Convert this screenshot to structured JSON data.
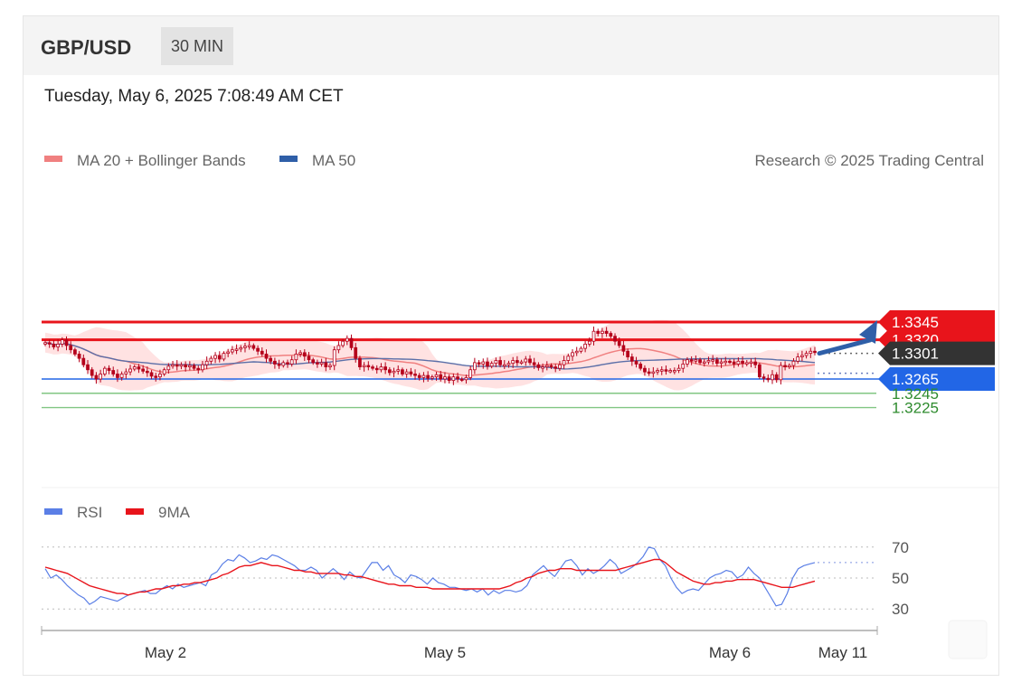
{
  "header": {
    "symbol": "GBP/USD",
    "timeframe": "30 MIN"
  },
  "datetime": "Tuesday, May 6, 2025 7:08:49 AM CET",
  "credit": "Research © 2025 Trading Central",
  "colors": {
    "resistance": "#e8141b",
    "support_blue": "#2266e6",
    "support_green": "#4caf50",
    "last": "#333333",
    "candle": "#b5001b",
    "ma20": "#f08080",
    "ma50": "#5b6fa8",
    "band": "#ffd6d6",
    "rsi": "#5b7fe6",
    "rsi_ma": "#e8141b",
    "arrow": "#2f5fa8"
  },
  "chart_data": [
    {
      "type": "candlestick",
      "title": "",
      "legend": [
        {
          "name": "MA 20 + Bollinger Bands",
          "color": "#f08080"
        },
        {
          "name": "MA 50",
          "color": "#2f5fa8"
        }
      ],
      "legend_position": "top-left",
      "x_ticks": [
        "May 2",
        "May 5",
        "May 6",
        "May 11"
      ],
      "ylim": [
        1.321,
        1.337
      ],
      "levels": [
        {
          "label": "1.3345",
          "value": 1.3345,
          "kind": "resistance"
        },
        {
          "label": "1.3320",
          "value": 1.332,
          "kind": "resistance"
        },
        {
          "label": "1.3301",
          "value": 1.3301,
          "kind": "last"
        },
        {
          "label": "1.3265",
          "value": 1.3265,
          "kind": "support"
        },
        {
          "label": "1.3245",
          "value": 1.3245,
          "kind": "support-minor"
        },
        {
          "label": "1.3225",
          "value": 1.3225,
          "kind": "support-minor"
        }
      ],
      "close": [
        1.3316,
        1.3314,
        1.331,
        1.3314,
        1.332,
        1.3312,
        1.3306,
        1.33,
        1.3294,
        1.3285,
        1.3278,
        1.327,
        1.3265,
        1.3272,
        1.328,
        1.3277,
        1.3272,
        1.3267,
        1.3272,
        1.3275,
        1.3279,
        1.3282,
        1.3279,
        1.3276,
        1.3274,
        1.3269,
        1.3268,
        1.3272,
        1.3278,
        1.3283,
        1.3285,
        1.3283,
        1.3285,
        1.3282,
        1.3284,
        1.328,
        1.3278,
        1.3285,
        1.329,
        1.3294,
        1.3298,
        1.3293,
        1.3301,
        1.3303,
        1.3306,
        1.3307,
        1.3309,
        1.3311,
        1.3312,
        1.3308,
        1.3304,
        1.33,
        1.3294,
        1.329,
        1.3286,
        1.3284,
        1.3288,
        1.3286,
        1.3292,
        1.33,
        1.3302,
        1.3297,
        1.3292,
        1.3288,
        1.3286,
        1.3288,
        1.3282,
        1.3284,
        1.3306,
        1.3312,
        1.3318,
        1.3322,
        1.3309,
        1.3294,
        1.3282,
        1.3284,
        1.3282,
        1.328,
        1.3278,
        1.3282,
        1.3278,
        1.3274,
        1.3276,
        1.3278,
        1.3272,
        1.3275,
        1.3272,
        1.327,
        1.3267,
        1.327,
        1.3266,
        1.3268,
        1.3271,
        1.3265,
        1.3268,
        1.3263,
        1.3268,
        1.3265,
        1.3264,
        1.3267,
        1.3278,
        1.3288,
        1.3286,
        1.3289,
        1.3283,
        1.3287,
        1.3291,
        1.3285,
        1.3285,
        1.3287,
        1.3291,
        1.3288,
        1.3289,
        1.3293,
        1.3288,
        1.3285,
        1.3281,
        1.3282,
        1.3284,
        1.3282,
        1.328,
        1.3285,
        1.3291,
        1.3297,
        1.3302,
        1.3304,
        1.3308,
        1.3314,
        1.3318,
        1.3332,
        1.3329,
        1.3332,
        1.3329,
        1.3325,
        1.3318,
        1.3312,
        1.3304,
        1.3296,
        1.329,
        1.3286,
        1.328,
        1.3275,
        1.3273,
        1.3275,
        1.3277,
        1.3278,
        1.3276,
        1.3277,
        1.3277,
        1.328,
        1.3286,
        1.3292,
        1.3291,
        1.3292,
        1.3288,
        1.3289,
        1.3291,
        1.3292,
        1.3287,
        1.3289,
        1.329,
        1.3289,
        1.3286,
        1.329,
        1.3287,
        1.3288,
        1.3289,
        1.3285,
        1.3268,
        1.3266,
        1.3264,
        1.3271,
        1.3264,
        1.3284,
        1.3282,
        1.3284,
        1.329,
        1.3296,
        1.3298,
        1.3301,
        1.3304,
        1.3303
      ]
    },
    {
      "type": "line",
      "legend": [
        {
          "name": "RSI",
          "color": "#5b7fe6"
        },
        {
          "name": "9MA",
          "color": "#e8141b"
        }
      ],
      "ylim": [
        20,
        80
      ],
      "y_ticks": [
        70,
        50,
        30
      ],
      "rsi": [
        56,
        50,
        52,
        49,
        45,
        42,
        39,
        37,
        33,
        35,
        38,
        37,
        36,
        35,
        37,
        39,
        40,
        41,
        42,
        40,
        40,
        43,
        45,
        43,
        46,
        44,
        45,
        46,
        47,
        45,
        52,
        54,
        59,
        62,
        61,
        65,
        63,
        60,
        61,
        63,
        62,
        65,
        64,
        62,
        60,
        58,
        55,
        55,
        57,
        55,
        50,
        53,
        56,
        53,
        49,
        54,
        51,
        50,
        55,
        60,
        60,
        55,
        58,
        52,
        50,
        47,
        52,
        51,
        49,
        46,
        50,
        47,
        46,
        44,
        44,
        43,
        42,
        43,
        41,
        43,
        39,
        42,
        40,
        42,
        42,
        41,
        42,
        45,
        52,
        55,
        58,
        54,
        51,
        56,
        61,
        62,
        58,
        52,
        56,
        53,
        55,
        58,
        62,
        59,
        53,
        55,
        57,
        60,
        64,
        70,
        69,
        62,
        58,
        50,
        44,
        40,
        42,
        43,
        42,
        46,
        50,
        52,
        53,
        55,
        54,
        50,
        52,
        57,
        53,
        50,
        44,
        38,
        32,
        33,
        40,
        50,
        56,
        58,
        59,
        60
      ],
      "rsi_ma": [
        57,
        56,
        55,
        54,
        53,
        51,
        49,
        47,
        45,
        44,
        43,
        42,
        41,
        40,
        40,
        39,
        40,
        41,
        41,
        42,
        43,
        43,
        44,
        45,
        45,
        46,
        46,
        47,
        47,
        48,
        49,
        50,
        52,
        53,
        55,
        57,
        58,
        58,
        59,
        60,
        59,
        58,
        58,
        57,
        56,
        55,
        55,
        54,
        54,
        53,
        53,
        53,
        53,
        53,
        52,
        52,
        51,
        51,
        50,
        49,
        48,
        47,
        46,
        46,
        45,
        45,
        45,
        44,
        44,
        44,
        43,
        43,
        43,
        43,
        43,
        43,
        43,
        43,
        43,
        43,
        43,
        43,
        43,
        44,
        45,
        47,
        48,
        50,
        51,
        53,
        54,
        55,
        55,
        56,
        56,
        56,
        55,
        55,
        55,
        55,
        55,
        55,
        55,
        55,
        56,
        57,
        58,
        59,
        60,
        61,
        62,
        62,
        60,
        57,
        54,
        52,
        50,
        48,
        47,
        46,
        46,
        47,
        47,
        48,
        48,
        49,
        49,
        49,
        49,
        48,
        47,
        46,
        45,
        44,
        44,
        44,
        45,
        46,
        47,
        48
      ]
    }
  ]
}
